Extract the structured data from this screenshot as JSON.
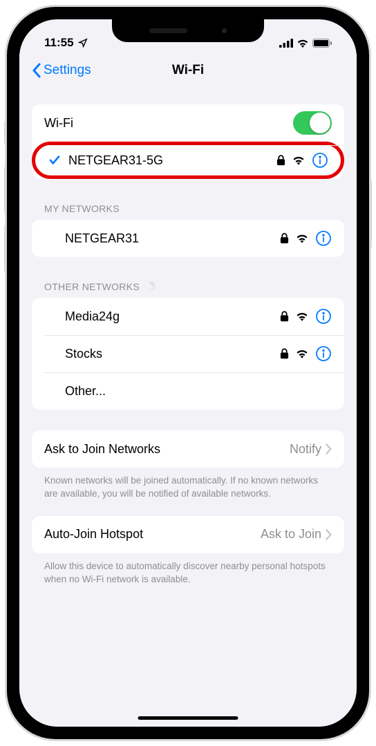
{
  "status": {
    "time": "11:55",
    "signal_bars": 4,
    "battery_level": 85
  },
  "nav": {
    "back_label": "Settings",
    "title": "Wi-Fi"
  },
  "wifi": {
    "toggle_label": "Wi-Fi",
    "enabled": true,
    "current": {
      "name": "NETGEAR31-5G",
      "secured": true
    }
  },
  "sections": {
    "my_networks": {
      "header": "MY NETWORKS",
      "items": [
        {
          "name": "NETGEAR31",
          "secured": true
        }
      ]
    },
    "other_networks": {
      "header": "OTHER NETWORKS",
      "loading": true,
      "items": [
        {
          "name": "Media24g",
          "secured": true
        },
        {
          "name": "Stocks",
          "secured": true
        }
      ],
      "other_label": "Other..."
    }
  },
  "ask_to_join": {
    "label": "Ask to Join Networks",
    "value": "Notify",
    "footer": "Known networks will be joined automatically. If no known networks are available, you will be notified of available networks."
  },
  "auto_join": {
    "label": "Auto-Join Hotspot",
    "value": "Ask to Join",
    "footer": "Allow this device to automatically discover nearby personal hotspots when no Wi-Fi network is available."
  }
}
